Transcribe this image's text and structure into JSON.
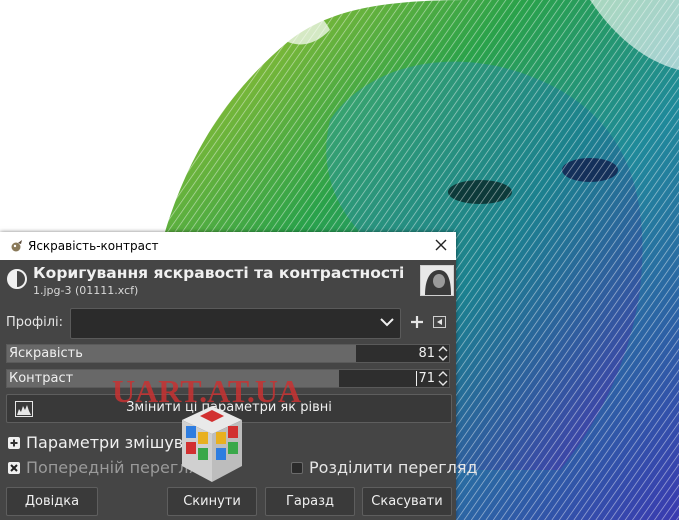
{
  "window": {
    "title": "Яскравість-контраст"
  },
  "header": {
    "title": "Коригування яскравості та контрастності",
    "subtitle": "1.jpg-3 (01111.xcf)"
  },
  "profiles": {
    "label": "Профілі:",
    "value": ""
  },
  "brightness": {
    "label": "Яскравість",
    "value": "81",
    "fill_fraction": 0.79
  },
  "contrast": {
    "label": "Контраст",
    "value": "71",
    "fill_fraction": 0.75
  },
  "levels_button": {
    "label": "Змінити ці параметри як рівні"
  },
  "blending": {
    "label": "Параметри змішування"
  },
  "preview": {
    "label": "Попередній перегляд",
    "checked": true
  },
  "split_view": {
    "label": "Розділити перегляд",
    "checked": false
  },
  "buttons": {
    "help": "Довідка",
    "reset": "Скинути",
    "ok": "Гаразд",
    "cancel": "Скасувати"
  },
  "watermark": {
    "text": "UART.AT.UA"
  },
  "colors": {
    "dialog_bg": "#454545",
    "watermark_red": "#c83232"
  }
}
